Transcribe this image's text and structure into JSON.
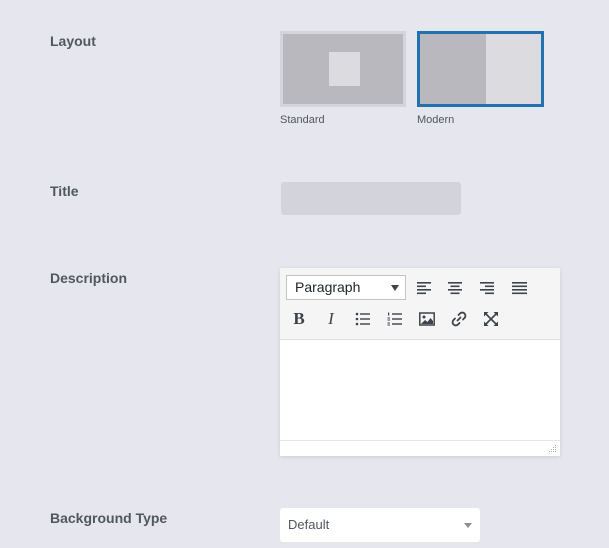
{
  "layout": {
    "label": "Layout",
    "options": [
      {
        "caption": "Standard",
        "selected": false
      },
      {
        "caption": "Modern",
        "selected": true
      }
    ],
    "selected_color": "#2271b1"
  },
  "title": {
    "label": "Title",
    "value": ""
  },
  "description": {
    "label": "Description",
    "format_select": "Paragraph",
    "toolbar_row1": [
      "align-left-icon",
      "align-center-icon",
      "align-right-icon",
      "align-justify-icon"
    ],
    "toolbar_row2": [
      "bold-icon",
      "italic-icon",
      "bullet-list-icon",
      "numbered-list-icon",
      "image-icon",
      "link-icon",
      "fullscreen-icon"
    ],
    "bold_glyph": "B",
    "italic_glyph": "I",
    "content": ""
  },
  "background_type": {
    "label": "Background Type",
    "value": "Default"
  }
}
